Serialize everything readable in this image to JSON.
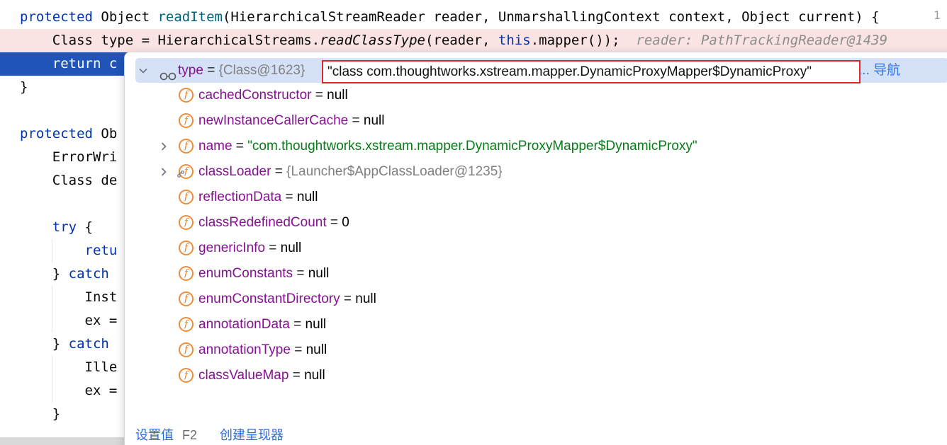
{
  "editor": {
    "line_number_hint": "1",
    "lines": {
      "l1": {
        "kw": "protected",
        "p1": " Object ",
        "mth": "readItem",
        "p2": "(HierarchicalStreamReader reader, UnmarshallingContext context, Object current) {"
      },
      "l2": {
        "p1": "    Class type = HierarchicalStreams.",
        "it": "readClassType",
        "p2": "(reader, ",
        "kw": "this",
        "p3": ".mapper());",
        "hint": "  reader: PathTrackingReader@1439"
      },
      "l3": {
        "kw": "    return",
        "p1": " c"
      },
      "l4": {
        "p1": "}"
      },
      "l5": {
        "kw": "protected",
        "p1": " Ob"
      },
      "l6": {
        "p1": "    ErrorWri"
      },
      "l7": {
        "p1": "    Class de"
      },
      "l8": {
        "kw": "    try",
        "p1": " {"
      },
      "l9": {
        "kw": "        retu"
      },
      "l10": {
        "p1": "    } ",
        "kw": "catch"
      },
      "l11": {
        "p1": "        Inst"
      },
      "l12": {
        "p1": "        ex ="
      },
      "l13": {
        "p1": "    } ",
        "kw": "catch"
      },
      "l14": {
        "p1": "        Ille"
      },
      "l15": {
        "p1": "        ex ="
      },
      "l16": {
        "p1": "    }"
      }
    }
  },
  "popup": {
    "root": {
      "name": "type",
      "eq": " = ",
      "ref": "{Class@1623}",
      "value": "\"class com.thoughtworks.xstream.mapper.DynamicProxyMapper$DynamicProxy\"",
      "nav_prefix": "... ",
      "nav": "导航"
    },
    "fields": [
      {
        "name": "cachedConstructor",
        "eq": " = ",
        "value": "null",
        "icon": "field-f-icon"
      },
      {
        "name": "newInstanceCallerCache",
        "eq": " = ",
        "value": "null",
        "icon": "field-f-icon"
      },
      {
        "name": "name",
        "eq": " = ",
        "value": "\"com.thoughtworks.xstream.mapper.DynamicProxyMapper$DynamicProxy\"",
        "icon": "field-f-icon"
      },
      {
        "name": "classLoader",
        "eq": " = ",
        "value": "{Launcher$AppClassLoader@1235}",
        "icon": "field-f-icon"
      },
      {
        "name": "reflectionData",
        "eq": " = ",
        "value": "null",
        "icon": "field-f-icon"
      },
      {
        "name": "classRedefinedCount",
        "eq": " = ",
        "value": "0",
        "icon": "field-f-icon"
      },
      {
        "name": "genericInfo",
        "eq": " = ",
        "value": "null",
        "icon": "field-f-icon"
      },
      {
        "name": "enumConstants",
        "eq": " = ",
        "value": "null",
        "icon": "field-f-icon"
      },
      {
        "name": "enumConstantDirectory",
        "eq": " = ",
        "value": "null",
        "icon": "field-f-icon"
      },
      {
        "name": "annotationData",
        "eq": " = ",
        "value": "null",
        "icon": "field-f-icon"
      },
      {
        "name": "annotationType",
        "eq": " = ",
        "value": "null",
        "icon": "field-f-icon"
      },
      {
        "name": "classValueMap",
        "eq": " = ",
        "value": "null",
        "icon": "field-f-icon"
      }
    ],
    "footer": {
      "set_value": "设置值",
      "set_value_key": "F2",
      "create_renderer": "创建呈现器"
    }
  },
  "colors": {
    "accent": "#3574f0",
    "current_line": "#2154b9",
    "breakpoint_line": "#fae3e3",
    "highlight_box": "#e0262a",
    "field_icon": "#ec8d3d"
  }
}
